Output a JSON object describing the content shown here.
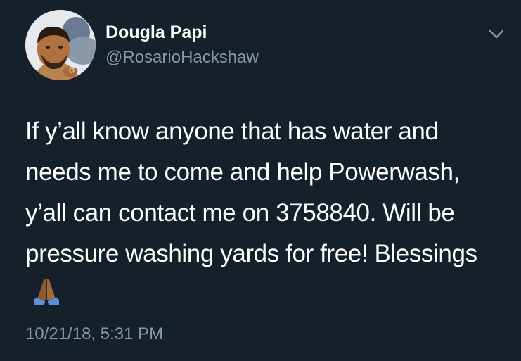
{
  "tweet": {
    "display_name": "Dougla Papi",
    "handle": "@RosarioHackshaw",
    "text": "If y’all know anyone that has water and needs me to come and help Powerwash, y’all can contact me on 3758840. Will be pressure washing yards for free! Blessings",
    "emoji_icon": "folded-hands-emoji",
    "timestamp": "10/21/18, 5:31 PM"
  },
  "icons": {
    "menu": "chevron-down-icon",
    "avatar": "profile-photo"
  },
  "colors": {
    "background": "#15202b",
    "primary_text": "#ffffff",
    "secondary_text": "#8899a6"
  }
}
